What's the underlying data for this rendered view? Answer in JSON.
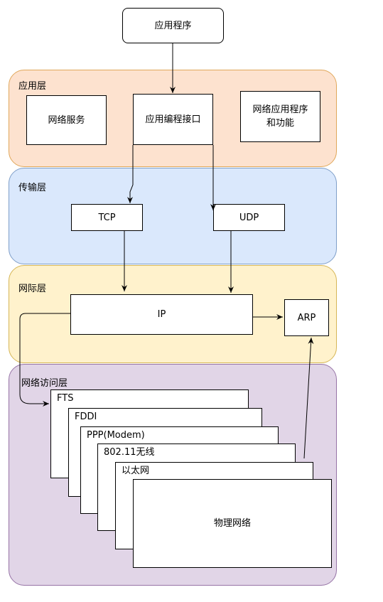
{
  "top_box": "应用程序",
  "layers": {
    "application": {
      "label": "应用层",
      "boxes": [
        "网络服务",
        "应用编程接口",
        "网络应用程序\n和功能"
      ],
      "fill": "#fde2cf",
      "stroke": "#e0a75a"
    },
    "transport": {
      "label": "传输层",
      "boxes": [
        "TCP",
        "UDP"
      ],
      "fill": "#dae8fc",
      "stroke": "#7f9fc9"
    },
    "internet": {
      "label": "网际层",
      "boxes": [
        "IP",
        "ARP"
      ],
      "fill": "#fff2cc",
      "stroke": "#d6b656"
    },
    "network_access": {
      "label": "网络访问层",
      "stack": [
        "FTS",
        "FDDI",
        "PPP(Modem)",
        "802.11无线",
        "以太网",
        "物理网络"
      ],
      "fill": "#e1d5e7",
      "stroke": "#9673a6"
    }
  }
}
